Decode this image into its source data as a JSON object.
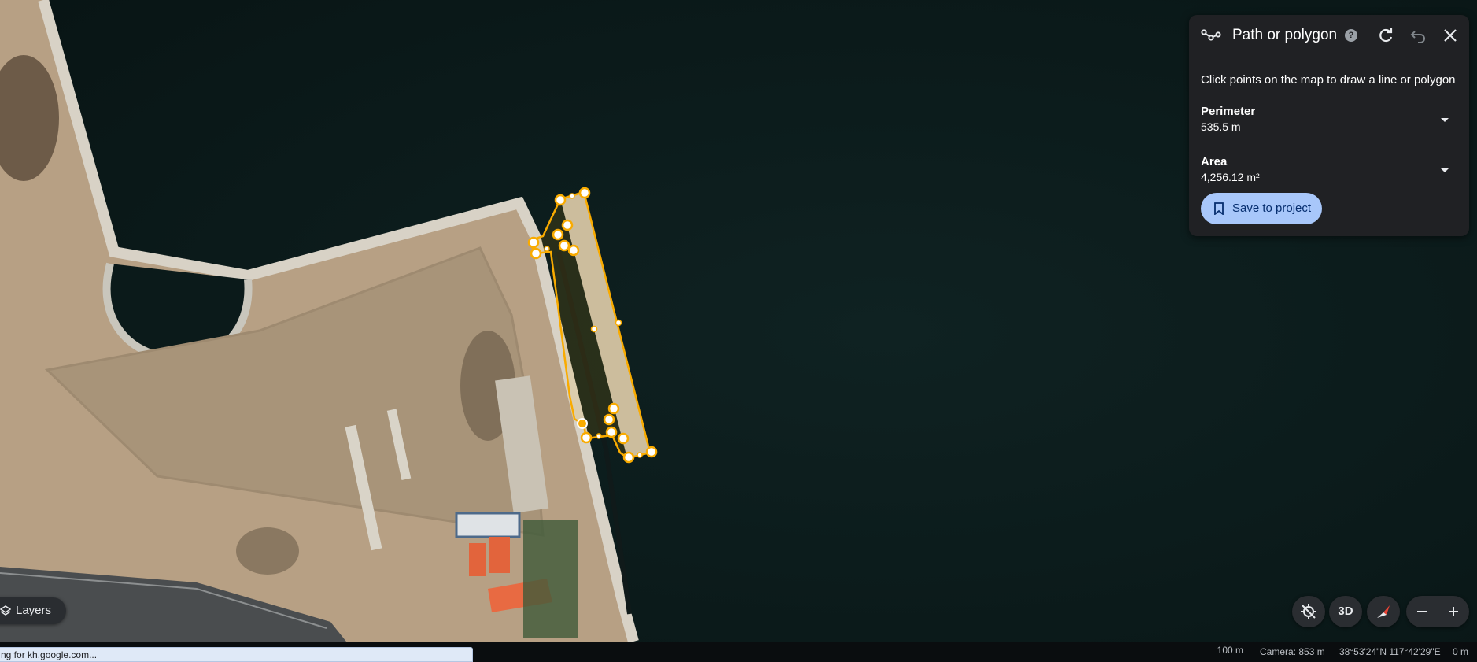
{
  "panel": {
    "title": "Path or polygon",
    "instruction": "Click points on the map to draw a line or polygon",
    "perimeter": {
      "label": "Perimeter",
      "value": "535.5 m"
    },
    "area": {
      "label": "Area",
      "value": "4,256.12 m²"
    },
    "save_label": "Save to project",
    "icons": [
      "path-icon",
      "help-icon",
      "redo-icon",
      "undo-icon",
      "close-icon",
      "chevron-down-icon",
      "bookmark-icon"
    ]
  },
  "controls": {
    "btn_3d": "3D",
    "layers_label": "Layers",
    "icons": [
      "locate-icon",
      "compass-icon",
      "zoom-out-icon",
      "zoom-in-icon",
      "layers-icon"
    ]
  },
  "status": {
    "scale_label": "100 m",
    "camera": "Camera: 853 m",
    "coords": "38°53'24\"N 117°42'29\"E",
    "elevation": "0 m"
  },
  "loading_text": "ng for kh.google.com...",
  "colors": {
    "panel_bg": "#202124",
    "accent_button": "#a8c7fa",
    "polygon_stroke": "#f9ab00",
    "water": "#0c1c1c",
    "land": "#b59f83"
  }
}
